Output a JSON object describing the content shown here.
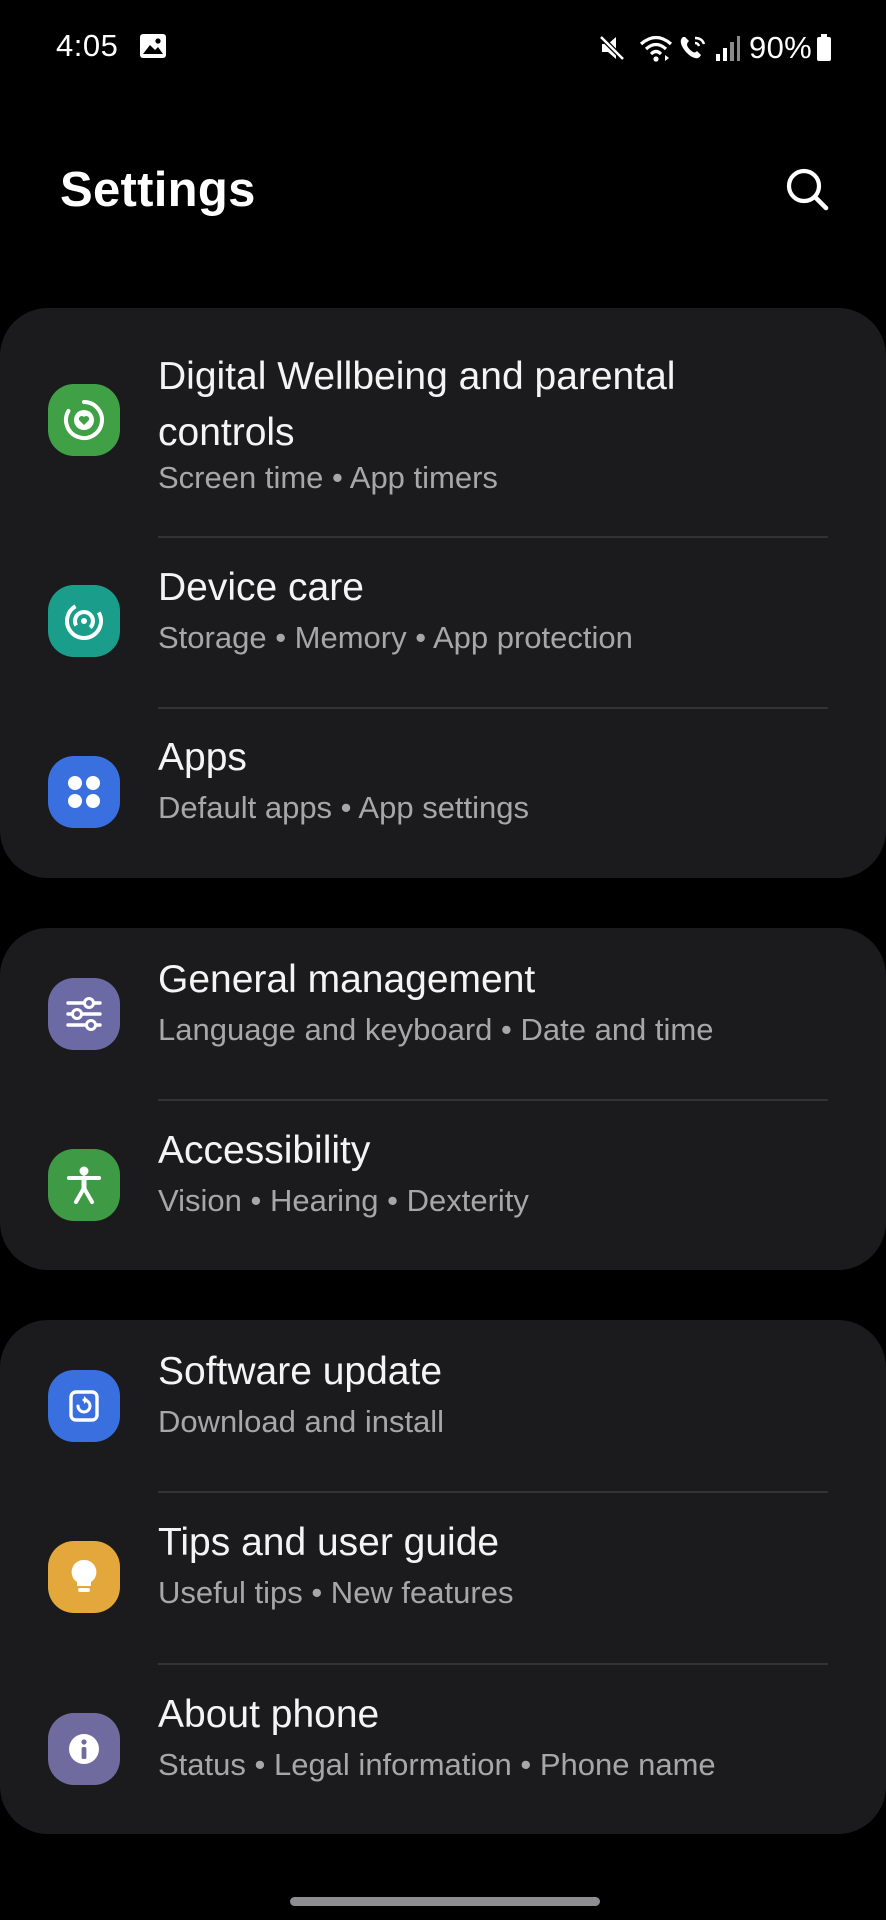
{
  "status_bar": {
    "time": "4:05",
    "battery": "90%",
    "icons": [
      "gallery-notification-icon",
      "mute-icon",
      "wifi-icon",
      "wifi-calling-icon",
      "signal-icon",
      "battery-icon"
    ]
  },
  "header": {
    "title": "Settings",
    "search_icon": "search-icon"
  },
  "groups": [
    {
      "items": [
        {
          "title_line1": "Digital Wellbeing and parental",
          "title_line2": "controls",
          "subtitle": "Screen time  •  App timers",
          "icon": "digital-wellbeing-icon",
          "icon_color": "#3fa046"
        },
        {
          "title": "Device care",
          "subtitle": "Storage  •  Memory  •  App protection",
          "icon": "device-care-icon",
          "icon_color": "#1a9e8b"
        },
        {
          "title": "Apps",
          "subtitle": "Default apps  •  App settings",
          "icon": "apps-icon",
          "icon_color": "#3a6fe0"
        }
      ]
    },
    {
      "items": [
        {
          "title": "General management",
          "subtitle": "Language and keyboard  •  Date and time",
          "icon": "general-management-icon",
          "icon_color": "#6c6aa4"
        },
        {
          "title": "Accessibility",
          "subtitle": "Vision  •  Hearing  •  Dexterity",
          "icon": "accessibility-icon",
          "icon_color": "#3f9a45"
        }
      ]
    },
    {
      "items": [
        {
          "title": "Software update",
          "subtitle": "Download and install",
          "icon": "software-update-icon",
          "icon_color": "#3a6fe0"
        },
        {
          "title": "Tips and user guide",
          "subtitle": "Useful tips  •  New features",
          "icon": "tips-icon",
          "icon_color": "#e4a73b"
        },
        {
          "title": "About phone",
          "subtitle": "Status  •  Legal information  •  Phone name",
          "icon": "about-phone-icon",
          "icon_color": "#6f6b9e"
        }
      ]
    }
  ]
}
